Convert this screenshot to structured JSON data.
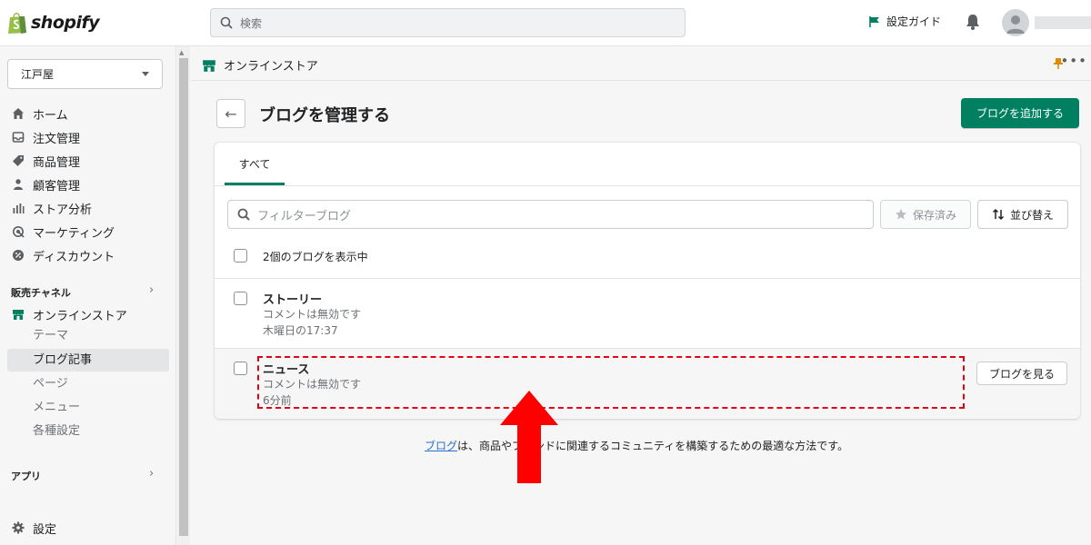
{
  "brand": {
    "logo_text": "shopify",
    "color": "#95bf47"
  },
  "topbar": {
    "search_placeholder": "検索",
    "setup_guide": "設定ガイド"
  },
  "sidebar": {
    "store_name": "江戸屋",
    "items": [
      {
        "label": "ホーム",
        "icon": "home-icon"
      },
      {
        "label": "注文管理",
        "icon": "inbox-icon"
      },
      {
        "label": "商品管理",
        "icon": "tag-icon"
      },
      {
        "label": "顧客管理",
        "icon": "person-icon"
      },
      {
        "label": "ストア分析",
        "icon": "bar-chart-icon"
      },
      {
        "label": "マーケティング",
        "icon": "target-icon"
      },
      {
        "label": "ディスカウント",
        "icon": "discount-icon"
      }
    ],
    "sales_channels_title": "販売チャネル",
    "online_store": "オンラインストア",
    "sub_items": [
      "テーマ",
      "ブログ記事",
      "ページ",
      "メニュー",
      "各種設定"
    ],
    "apps_title": "アプリ",
    "settings": "設定"
  },
  "app_header": {
    "title": "オンラインストア"
  },
  "page": {
    "title": "ブログを管理する",
    "primary_action": "ブログを追加する",
    "tab_all": "すべて",
    "filter_placeholder": "フィルターブログ",
    "saved_label": "保存済み",
    "sort_label": "並び替え",
    "count_text": "2個のブログを表示中",
    "blogs": [
      {
        "title": "ストーリー",
        "comments": "コメントは無効です",
        "updated": "木曜日の17:37"
      },
      {
        "title": "ニュース",
        "comments": "コメントは無効です",
        "updated": "6分前",
        "action": "ブログを見る"
      }
    ],
    "footer_link": "ブログ",
    "footer_text": "は、商品やブランドに関連するコミュニティを構築するための最適な方法です。"
  },
  "colors": {
    "primary": "#008060",
    "annotation": "#e50012",
    "link": "#2c6ecb"
  }
}
